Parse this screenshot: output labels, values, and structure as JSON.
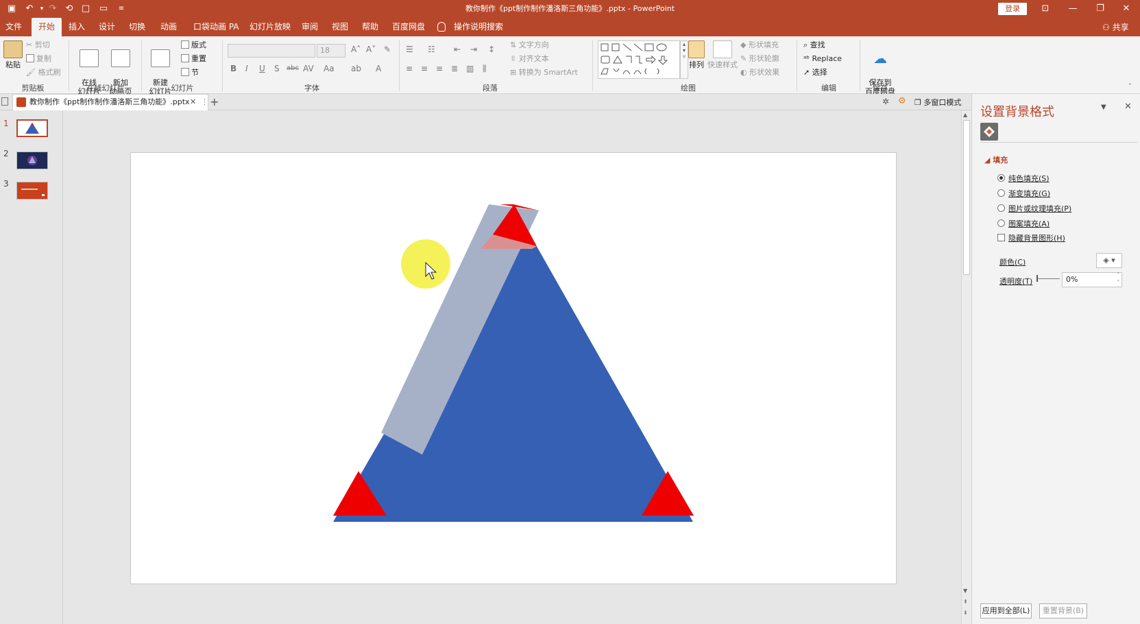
{
  "titlebar": {
    "title": "教你制作《ppt制作制作潘洛斯三角功能》.pptx  -  PowerPoint",
    "login": "登录",
    "share": "共享"
  },
  "tabs": [
    {
      "label": "文件",
      "active": false
    },
    {
      "label": "开始",
      "active": true
    },
    {
      "label": "插入",
      "active": false
    },
    {
      "label": "设计",
      "active": false
    },
    {
      "label": "切换",
      "active": false
    },
    {
      "label": "动画",
      "active": false
    },
    {
      "label": "口袋动画 PA",
      "active": false
    },
    {
      "label": "幻灯片放映",
      "active": false
    },
    {
      "label": "审阅",
      "active": false
    },
    {
      "label": "视图",
      "active": false
    },
    {
      "label": "帮助",
      "active": false
    },
    {
      "label": "百度网盘",
      "active": false
    },
    {
      "label": "操作说明搜索",
      "active": false
    }
  ],
  "ribbon": {
    "clipboard": {
      "group": "剪贴板",
      "paste": "粘贴",
      "cut": "剪切",
      "copy": "复制",
      "painter": "格式刷"
    },
    "online": {
      "group": "在线幻灯片",
      "online_slide": "在线\n幻灯片",
      "new_anim": "新加\n动画页"
    },
    "slides": {
      "group": "幻灯片",
      "new_slide": "新建\n幻灯片",
      "layout": "版式",
      "reset": "重置",
      "section": "节"
    },
    "font": {
      "group": "字体",
      "font_size": "18"
    },
    "paragraph": {
      "group": "段落",
      "text_dir": "文字方向",
      "align_text": "对齐文本",
      "smartart": "转换为 SmartArt"
    },
    "drawing": {
      "group": "绘图",
      "arrange": "排列",
      "quick_styles": "快速样式",
      "shape_fill": "形状填充",
      "shape_outline": "形状轮廓",
      "shape_effects": "形状效果"
    },
    "editing": {
      "group": "编辑",
      "find": "查找",
      "replace": "Replace",
      "select": "选择"
    },
    "save": {
      "group": "保存",
      "save_to": "保存到\n百度网盘"
    }
  },
  "doc_tab": {
    "label": "教你制作《ppt制作制作潘洛斯三角功能》.pptx",
    "multi_window": "多窗口模式"
  },
  "slides": [
    {
      "number": "1",
      "selected": true
    },
    {
      "number": "2",
      "selected": false
    },
    {
      "number": "3",
      "selected": false
    }
  ],
  "pane": {
    "title": "设置背景格式",
    "section": "填充",
    "options": [
      {
        "label": "纯色填充(S)",
        "type": "radio",
        "checked": true
      },
      {
        "label": "渐变填充(G)",
        "type": "radio",
        "checked": false
      },
      {
        "label": "图片或纹理填充(P)",
        "type": "radio",
        "checked": false
      },
      {
        "label": "图案填充(A)",
        "type": "radio",
        "checked": false
      },
      {
        "label": "隐藏背景图形(H)",
        "type": "checkbox",
        "checked": false
      }
    ],
    "color_label": "颜色(C)",
    "transparency_label": "透明度(T)",
    "transparency_value": "0%",
    "apply_all": "应用到全部(L)",
    "reset_bg": "重置背景(B)"
  },
  "colors": {
    "accent": "#b7472a",
    "triangle_blue": "#3560b4",
    "triangle_light": "#a6b1c8",
    "corner_red": "#ee0000",
    "corner_pink": "#d99090",
    "cursor_highlight": "#f3f03c"
  }
}
